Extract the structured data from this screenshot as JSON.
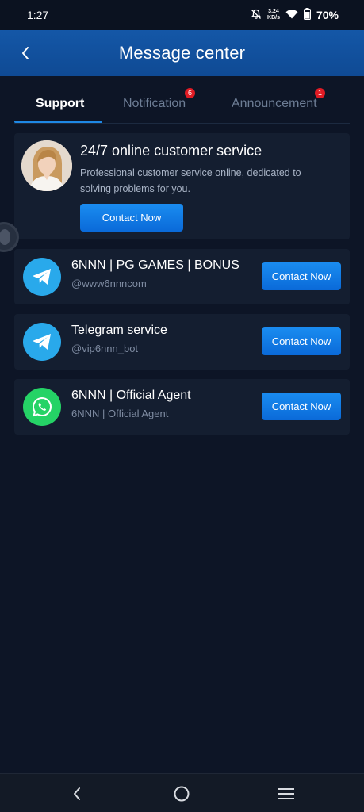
{
  "status_bar": {
    "time": "1:27",
    "net_speed_value": "3.24",
    "net_speed_unit": "KB/s",
    "battery": "70%"
  },
  "header": {
    "title": "Message center"
  },
  "tabs": [
    {
      "label": "Support",
      "active": true
    },
    {
      "label": "Notification",
      "badge": "6"
    },
    {
      "label": "Announcement",
      "badge": "1"
    }
  ],
  "customer_service": {
    "title": "24/7 online customer service",
    "description": "Professional customer service online, dedicated to solving problems for you.",
    "button": "Contact Now"
  },
  "contacts": [
    {
      "icon": "telegram-icon",
      "title": "6NNN | PG GAMES | BONUS",
      "subtitle": "@www6nnncom",
      "button": "Contact Now"
    },
    {
      "icon": "telegram-icon",
      "title": "Telegram service",
      "subtitle": "@vip6nnn_bot",
      "button": "Contact Now"
    },
    {
      "icon": "whatsapp-icon",
      "title": "6NNN | Official Agent",
      "subtitle": "6NNN | Official Agent",
      "button": "Contact Now"
    }
  ],
  "colors": {
    "background": "#0d1526",
    "header": "#1457a7",
    "accent": "#1e88e5",
    "card": "#141e30",
    "badge": "#e01b24",
    "telegram": "#29a9eb",
    "whatsapp": "#25d366"
  }
}
